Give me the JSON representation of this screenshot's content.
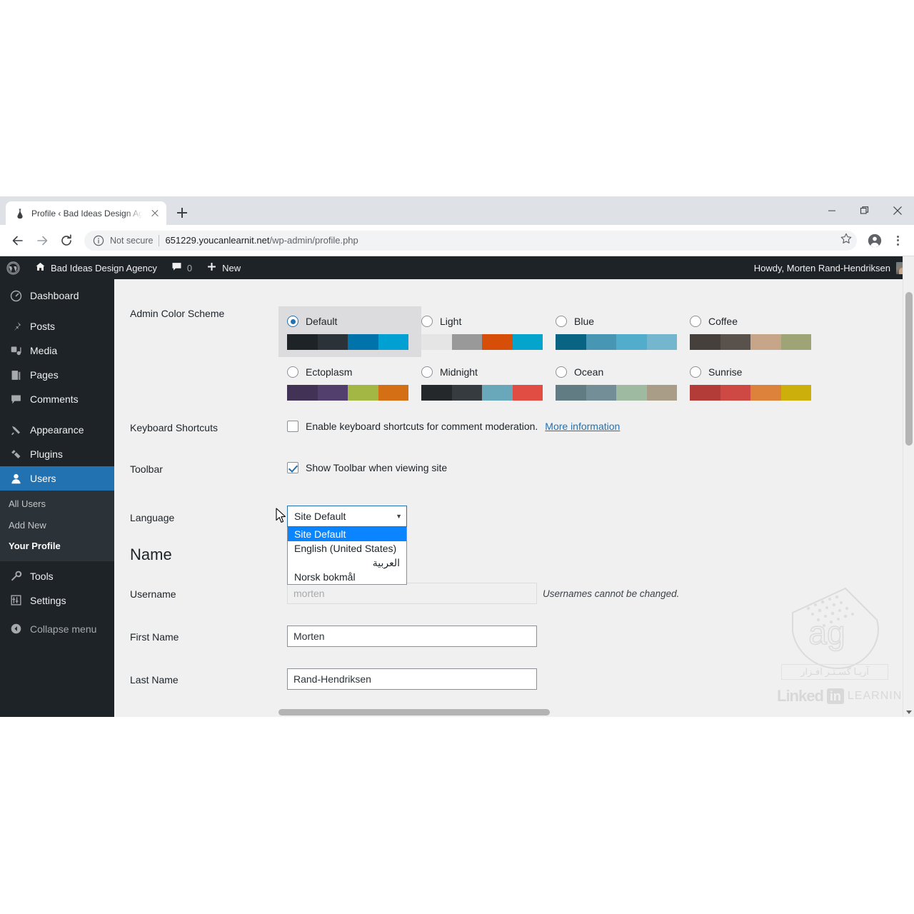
{
  "browser": {
    "tab": {
      "title": "Profile ‹ Bad Ideas Design Agency",
      "favicon": "flask-icon",
      "close": "×"
    },
    "newtab_label": "+",
    "window_controls": {
      "minimize": "minimize-icon",
      "maximize": "maximize-icon",
      "close": "close-icon"
    },
    "nav": {
      "back": "back-arrow-icon",
      "forward": "forward-arrow-icon",
      "reload": "reload-icon"
    },
    "omnibox": {
      "info_icon": "info-circle-icon",
      "security_label": "Not secure",
      "url_host": "651229.youcanlearnit.net",
      "url_path": "/wp-admin/profile.php",
      "star": "star-icon",
      "profile": "account-circle-icon",
      "menu": "kebab-menu-icon"
    }
  },
  "adminbar": {
    "wp_logo": "wordpress-logo-icon",
    "home_icon": "home-icon",
    "site_name": "Bad Ideas Design Agency",
    "comments_icon": "comment-bubble-icon",
    "comments_count": "0",
    "new_icon": "plus-icon",
    "new_label": "New",
    "howdy": "Howdy, Morten Rand-Hendriksen",
    "avatar": "user-avatar"
  },
  "sidebar": {
    "items": [
      {
        "label": "Dashboard",
        "icon": "dashboard-icon",
        "current": false
      },
      {
        "label": "Posts",
        "icon": "pin-icon",
        "current": false
      },
      {
        "label": "Media",
        "icon": "media-icon",
        "current": false
      },
      {
        "label": "Pages",
        "icon": "pages-icon",
        "current": false
      },
      {
        "label": "Comments",
        "icon": "comment-icon",
        "current": false
      },
      {
        "label": "Appearance",
        "icon": "brush-icon",
        "current": false
      },
      {
        "label": "Plugins",
        "icon": "plug-icon",
        "current": false
      },
      {
        "label": "Users",
        "icon": "user-icon",
        "current": true
      }
    ],
    "submenu": [
      {
        "label": "All Users",
        "current": false
      },
      {
        "label": "Add New",
        "current": false
      },
      {
        "label": "Your Profile",
        "current": true
      }
    ],
    "items_after": [
      {
        "label": "Tools",
        "icon": "wrench-icon"
      },
      {
        "label": "Settings",
        "icon": "settings-sliders-icon"
      }
    ],
    "collapse": {
      "label": "Collapse menu",
      "icon": "collapse-arrow-icon"
    }
  },
  "form": {
    "color_scheme": {
      "label": "Admin Color Scheme",
      "selected": "Default",
      "options": [
        {
          "name": "Default",
          "selected": true,
          "colors": [
            "#1d2327",
            "#2c3338",
            "#0073aa",
            "#00a0d2"
          ]
        },
        {
          "name": "Light",
          "selected": false,
          "colors": [
            "#e5e5e5",
            "#999999",
            "#d64e07",
            "#04a4cc"
          ]
        },
        {
          "name": "Blue",
          "selected": false,
          "colors": [
            "#096484",
            "#4796b3",
            "#52accc",
            "#74b6ce"
          ]
        },
        {
          "name": "Coffee",
          "selected": false,
          "colors": [
            "#46403c",
            "#59524c",
            "#c7a589",
            "#9ea476"
          ]
        },
        {
          "name": "Ectoplasm",
          "selected": false,
          "colors": [
            "#413256",
            "#523f6d",
            "#a3b745",
            "#d46f15"
          ]
        },
        {
          "name": "Midnight",
          "selected": false,
          "colors": [
            "#25282b",
            "#363b3f",
            "#69a8bb",
            "#e14d43"
          ]
        },
        {
          "name": "Ocean",
          "selected": false,
          "colors": [
            "#627c83",
            "#738e96",
            "#9ebaa0",
            "#aa9d88"
          ]
        },
        {
          "name": "Sunrise",
          "selected": false,
          "colors": [
            "#b43c38",
            "#cf4944",
            "#dd823b",
            "#ccaf0b"
          ]
        }
      ]
    },
    "keyboard_shortcuts": {
      "label": "Keyboard Shortcuts",
      "checkbox_label": "Enable keyboard shortcuts for comment moderation.",
      "checked": false,
      "more_info": "More information"
    },
    "toolbar": {
      "label": "Toolbar",
      "checkbox_label": "Show Toolbar when viewing site",
      "checked": true
    },
    "language": {
      "label": "Language",
      "value": "Site Default",
      "caret": "▼",
      "open": true,
      "options": [
        {
          "label": "Site Default",
          "highlighted": true,
          "rtl": false
        },
        {
          "label": "English (United States)",
          "highlighted": false,
          "rtl": false
        },
        {
          "label": "العربية",
          "highlighted": false,
          "rtl": true
        },
        {
          "label": "Norsk bokmål",
          "highlighted": false,
          "rtl": false
        }
      ]
    },
    "name_section_title": "Name",
    "username": {
      "label": "Username",
      "value": "morten",
      "disabled": true,
      "hint": "Usernames cannot be changed."
    },
    "first_name": {
      "label": "First Name",
      "value": "Morten"
    },
    "last_name": {
      "label": "Last Name",
      "value": "Rand-Hendriksen"
    }
  },
  "watermark": {
    "persian_text": "آریـا گسـتـر افـزار",
    "linkedin_word": "Linked",
    "linkedin_in": "in",
    "learning": "LEARNING"
  },
  "colors": {
    "wp_dark": "#1d2327",
    "wp_submenu": "#2c3338",
    "wp_blue": "#2271b1",
    "wp_bg": "#f0f0f1",
    "dropdown_highlight": "#0a84ff",
    "link": "#2271b1"
  }
}
